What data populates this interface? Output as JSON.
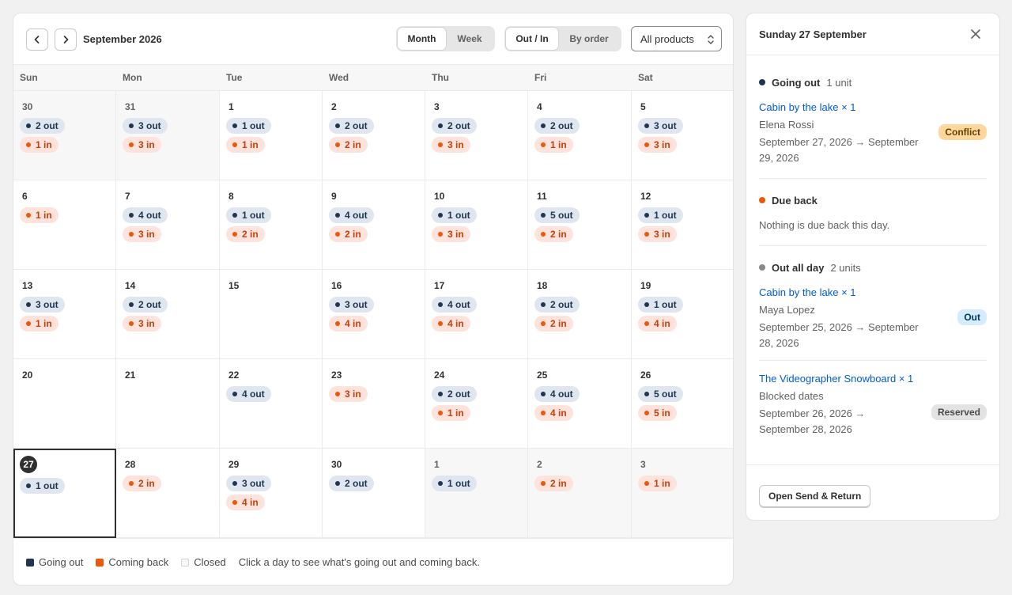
{
  "calendar": {
    "month_label": "September 2026",
    "view_tabs": [
      {
        "label": "Month",
        "active": true
      },
      {
        "label": "Week",
        "active": false
      }
    ],
    "mode_tabs": [
      {
        "label": "Out / In",
        "active": true
      },
      {
        "label": "By order",
        "active": false
      }
    ],
    "product_filter": "All products",
    "weekdays": [
      "Sun",
      "Mon",
      "Tue",
      "Wed",
      "Thu",
      "Fri",
      "Sat"
    ],
    "weeks": [
      [
        {
          "day": "30",
          "muted": true,
          "out": "2 out",
          "in": "1 in"
        },
        {
          "day": "31",
          "muted": true,
          "out": "3 out",
          "in": "3 in"
        },
        {
          "day": "1",
          "out": "1 out",
          "in": "1 in"
        },
        {
          "day": "2",
          "out": "2 out",
          "in": "2 in"
        },
        {
          "day": "3",
          "out": "2 out",
          "in": "3 in"
        },
        {
          "day": "4",
          "out": "2 out",
          "in": "1 in"
        },
        {
          "day": "5",
          "out": "3 out",
          "in": "3 in"
        }
      ],
      [
        {
          "day": "6",
          "in": "1 in"
        },
        {
          "day": "7",
          "out": "4 out",
          "in": "3 in"
        },
        {
          "day": "8",
          "out": "1 out",
          "in": "2 in"
        },
        {
          "day": "9",
          "out": "4 out",
          "in": "2 in"
        },
        {
          "day": "10",
          "out": "1 out",
          "in": "3 in"
        },
        {
          "day": "11",
          "out": "5 out",
          "in": "2 in"
        },
        {
          "day": "12",
          "out": "1 out",
          "in": "3 in"
        }
      ],
      [
        {
          "day": "13",
          "out": "3 out",
          "in": "1 in"
        },
        {
          "day": "14",
          "out": "2 out",
          "in": "3 in"
        },
        {
          "day": "15"
        },
        {
          "day": "16",
          "out": "3 out",
          "in": "4 in"
        },
        {
          "day": "17",
          "out": "4 out",
          "in": "4 in"
        },
        {
          "day": "18",
          "out": "2 out",
          "in": "2 in"
        },
        {
          "day": "19",
          "out": "1 out",
          "in": "4 in"
        }
      ],
      [
        {
          "day": "20"
        },
        {
          "day": "21"
        },
        {
          "day": "22",
          "out": "4 out"
        },
        {
          "day": "23",
          "in": "3 in"
        },
        {
          "day": "24",
          "out": "2 out",
          "in": "1 in"
        },
        {
          "day": "25",
          "out": "4 out",
          "in": "4 in"
        },
        {
          "day": "26",
          "out": "5 out",
          "in": "5 in"
        }
      ],
      [
        {
          "day": "27",
          "today": true,
          "selected": true,
          "out": "1 out"
        },
        {
          "day": "28",
          "in": "2 in"
        },
        {
          "day": "29",
          "out": "3 out",
          "in": "4 in"
        },
        {
          "day": "30",
          "out": "2 out"
        },
        {
          "day": "1",
          "muted": true,
          "out": "1 out"
        },
        {
          "day": "2",
          "muted": true,
          "in": "2 in"
        },
        {
          "day": "3",
          "muted": true,
          "in": "1 in"
        }
      ]
    ],
    "legend": {
      "going_out": "Going out",
      "coming_back": "Coming back",
      "closed": "Closed",
      "hint": "Click a day to see what's going out and coming back."
    }
  },
  "panel": {
    "title": "Sunday 27 September",
    "going_out": {
      "label": "Going out",
      "count": "1 unit",
      "entries": [
        {
          "link": "Cabin by the lake × 1",
          "person": "Elena Rossi",
          "dates": "September 27, 2026 → September 29, 2026",
          "badge": "Conflict"
        }
      ]
    },
    "due_back": {
      "label": "Due back",
      "empty": "Nothing is due back this day."
    },
    "out_all_day": {
      "label": "Out all day",
      "count": "2 units",
      "entries": [
        {
          "link": "Cabin by the lake × 1",
          "person": "Maya Lopez",
          "dates": "September 25, 2026 → September 28, 2026",
          "badge": "Out"
        },
        {
          "link": "The Videographer Snowboard × 1",
          "person": "Blocked dates",
          "dates": "September 26, 2026 → September 28, 2026",
          "badge": "Reserved"
        }
      ]
    },
    "action": "Open Send & Return"
  },
  "colors": {
    "going_out": "#1f3550",
    "coming_back": "#ea580c",
    "out_all_day": "#8a8a8a",
    "link": "#005bd3"
  }
}
